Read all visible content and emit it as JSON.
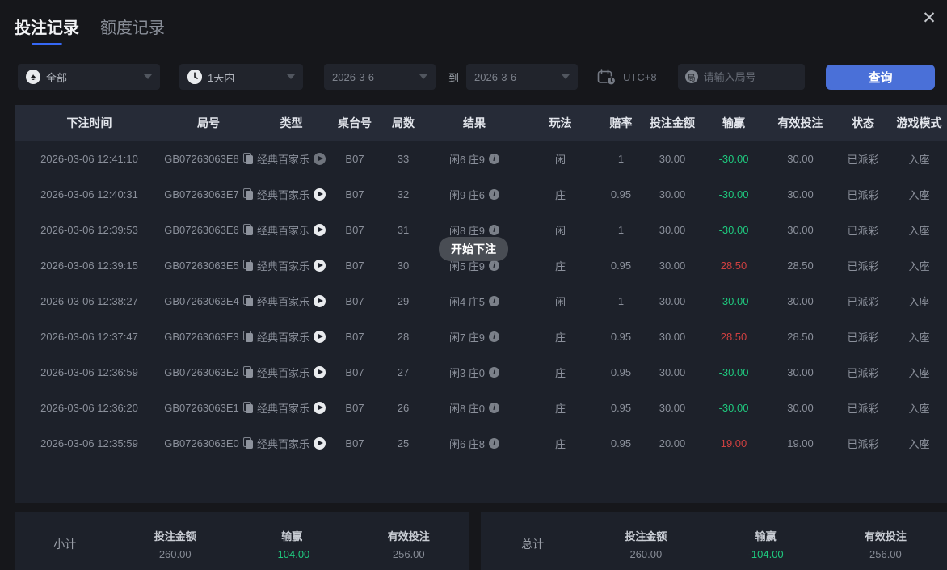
{
  "window": {
    "close_icon": "✕"
  },
  "tabs": [
    {
      "label": "投注记录",
      "active": true
    },
    {
      "label": "额度记录",
      "active": false
    }
  ],
  "filters": {
    "game_type_value": "全部",
    "game_type_icon_char": "♠",
    "time_range_value": "1天内",
    "date_from": "2026-3-6",
    "to_label": "到",
    "date_to": "2026-3-6",
    "timezone_label": "UTC+8",
    "round_input_placeholder": "请输入局号",
    "round_input_icon_char": "局",
    "search_button_label": "查询"
  },
  "toast_text": "开始下注",
  "table": {
    "headers": [
      "下注时间",
      "局号",
      "类型",
      "桌台号",
      "局数",
      "结果",
      "玩法",
      "赔率",
      "投注金额",
      "输赢",
      "有效投注",
      "状态",
      "游戏模式"
    ],
    "rows": [
      {
        "time": "2026-03-06 12:41:10",
        "id": "GB07263063E8",
        "type": "经典百家乐",
        "play_dimmed": true,
        "table_no": "B07",
        "rounds": "33",
        "result": "闲6 庄9",
        "play": "闲",
        "odds": "1",
        "amount": "30.00",
        "winloss": "-30.00",
        "valid": "30.00",
        "status": "已派彩",
        "mode": "入座"
      },
      {
        "time": "2026-03-06 12:40:31",
        "id": "GB07263063E7",
        "type": "经典百家乐",
        "play_dimmed": false,
        "table_no": "B07",
        "rounds": "32",
        "result": "闲9 庄6",
        "play": "庄",
        "odds": "0.95",
        "amount": "30.00",
        "winloss": "-30.00",
        "valid": "30.00",
        "status": "已派彩",
        "mode": "入座"
      },
      {
        "time": "2026-03-06 12:39:53",
        "id": "GB07263063E6",
        "type": "经典百家乐",
        "play_dimmed": false,
        "table_no": "B07",
        "rounds": "31",
        "result": "闲8 庄9",
        "play": "闲",
        "odds": "1",
        "amount": "30.00",
        "winloss": "-30.00",
        "valid": "30.00",
        "status": "已派彩",
        "mode": "入座"
      },
      {
        "time": "2026-03-06 12:39:15",
        "id": "GB07263063E5",
        "type": "经典百家乐",
        "play_dimmed": false,
        "table_no": "B07",
        "rounds": "30",
        "result": "闲5 庄9",
        "play": "庄",
        "odds": "0.95",
        "amount": "30.00",
        "winloss": "28.50",
        "valid": "28.50",
        "status": "已派彩",
        "mode": "入座"
      },
      {
        "time": "2026-03-06 12:38:27",
        "id": "GB07263063E4",
        "type": "经典百家乐",
        "play_dimmed": false,
        "table_no": "B07",
        "rounds": "29",
        "result": "闲4 庄5",
        "play": "闲",
        "odds": "1",
        "amount": "30.00",
        "winloss": "-30.00",
        "valid": "30.00",
        "status": "已派彩",
        "mode": "入座"
      },
      {
        "time": "2026-03-06 12:37:47",
        "id": "GB07263063E3",
        "type": "经典百家乐",
        "play_dimmed": false,
        "table_no": "B07",
        "rounds": "28",
        "result": "闲7 庄9",
        "play": "庄",
        "odds": "0.95",
        "amount": "30.00",
        "winloss": "28.50",
        "valid": "28.50",
        "status": "已派彩",
        "mode": "入座"
      },
      {
        "time": "2026-03-06 12:36:59",
        "id": "GB07263063E2",
        "type": "经典百家乐",
        "play_dimmed": false,
        "table_no": "B07",
        "rounds": "27",
        "result": "闲3 庄0",
        "play": "庄",
        "odds": "0.95",
        "amount": "30.00",
        "winloss": "-30.00",
        "valid": "30.00",
        "status": "已派彩",
        "mode": "入座"
      },
      {
        "time": "2026-03-06 12:36:20",
        "id": "GB07263063E1",
        "type": "经典百家乐",
        "play_dimmed": false,
        "table_no": "B07",
        "rounds": "26",
        "result": "闲8 庄0",
        "play": "庄",
        "odds": "0.95",
        "amount": "30.00",
        "winloss": "-30.00",
        "valid": "30.00",
        "status": "已派彩",
        "mode": "入座"
      },
      {
        "time": "2026-03-06 12:35:59",
        "id": "GB07263063E0",
        "type": "经典百家乐",
        "play_dimmed": false,
        "table_no": "B07",
        "rounds": "25",
        "result": "闲6 庄8",
        "play": "庄",
        "odds": "0.95",
        "amount": "20.00",
        "winloss": "19.00",
        "valid": "19.00",
        "status": "已派彩",
        "mode": "入座"
      }
    ]
  },
  "summary": {
    "subtotal": {
      "label": "小计",
      "bet_label": "投注金额",
      "bet": "260.00",
      "winloss_label": "输赢",
      "winloss": "-104.00",
      "valid_label": "有效投注",
      "valid": "256.00"
    },
    "total": {
      "label": "总计",
      "bet_label": "投注金额",
      "bet": "260.00",
      "winloss_label": "输赢",
      "winloss": "-104.00",
      "valid_label": "有效投注",
      "valid": "256.00"
    }
  },
  "colors": {
    "accent_blue": "#4a70d8",
    "win_red": "#cf4040",
    "loss_green": "#1fc87e",
    "tab_underline": "#3668f5"
  }
}
